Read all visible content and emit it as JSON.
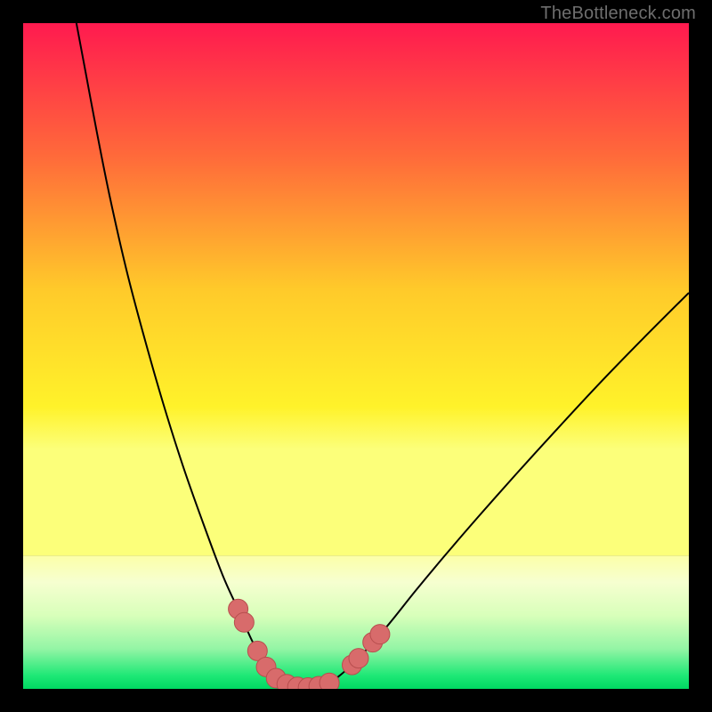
{
  "watermark": "TheBottleneck.com",
  "chart_data": {
    "type": "line",
    "title": "",
    "xlabel": "",
    "ylabel": "",
    "xlim": [
      0,
      100
    ],
    "ylim": [
      0,
      100
    ],
    "background_gradient_main": [
      {
        "offset": 0.0,
        "color": "#ff1a4f"
      },
      {
        "offset": 0.25,
        "color": "#ff6a3a"
      },
      {
        "offset": 0.5,
        "color": "#ffca2a"
      },
      {
        "offset": 0.72,
        "color": "#fff22a"
      },
      {
        "offset": 0.8,
        "color": "#fcff7a"
      }
    ],
    "bottom_band": {
      "start_y": 80,
      "colors": [
        {
          "offset": 0.0,
          "color": "#fcffa8"
        },
        {
          "offset": 0.2,
          "color": "#f6ffd0"
        },
        {
          "offset": 0.45,
          "color": "#d8ffba"
        },
        {
          "offset": 0.7,
          "color": "#93f5a5"
        },
        {
          "offset": 0.9,
          "color": "#1ee876"
        },
        {
          "offset": 1.0,
          "color": "#00d962"
        }
      ]
    },
    "curve_left": [
      {
        "x": 8.0,
        "y": 100.0
      },
      {
        "x": 9.5,
        "y": 92.0
      },
      {
        "x": 11.0,
        "y": 84.0
      },
      {
        "x": 13.0,
        "y": 74.0
      },
      {
        "x": 15.5,
        "y": 63.0
      },
      {
        "x": 18.0,
        "y": 53.5
      },
      {
        "x": 21.0,
        "y": 43.0
      },
      {
        "x": 24.0,
        "y": 33.5
      },
      {
        "x": 27.0,
        "y": 25.0
      },
      {
        "x": 30.0,
        "y": 17.0
      },
      {
        "x": 32.5,
        "y": 11.5
      },
      {
        "x": 34.5,
        "y": 7.0
      },
      {
        "x": 36.5,
        "y": 3.8
      },
      {
        "x": 38.5,
        "y": 1.7
      },
      {
        "x": 40.5,
        "y": 0.6
      },
      {
        "x": 42.0,
        "y": 0.2
      }
    ],
    "curve_right": [
      {
        "x": 44.0,
        "y": 0.2
      },
      {
        "x": 46.0,
        "y": 0.9
      },
      {
        "x": 48.5,
        "y": 2.8
      },
      {
        "x": 51.5,
        "y": 5.8
      },
      {
        "x": 55.0,
        "y": 9.8
      },
      {
        "x": 59.0,
        "y": 14.8
      },
      {
        "x": 63.5,
        "y": 20.2
      },
      {
        "x": 68.5,
        "y": 26.0
      },
      {
        "x": 74.0,
        "y": 32.2
      },
      {
        "x": 80.0,
        "y": 38.8
      },
      {
        "x": 86.5,
        "y": 45.8
      },
      {
        "x": 93.0,
        "y": 52.5
      },
      {
        "x": 100.0,
        "y": 59.5
      }
    ],
    "floor_line": {
      "x1": 42.0,
      "x2": 44.0,
      "y": 0.2
    },
    "markers": [
      {
        "x": 32.3,
        "y": 12.0
      },
      {
        "x": 33.2,
        "y": 10.0
      },
      {
        "x": 35.2,
        "y": 5.7
      },
      {
        "x": 36.5,
        "y": 3.3
      },
      {
        "x": 38.0,
        "y": 1.6
      },
      {
        "x": 39.6,
        "y": 0.7
      },
      {
        "x": 41.2,
        "y": 0.3
      },
      {
        "x": 42.8,
        "y": 0.2
      },
      {
        "x": 44.4,
        "y": 0.4
      },
      {
        "x": 46.0,
        "y": 0.9
      },
      {
        "x": 49.4,
        "y": 3.6
      },
      {
        "x": 50.4,
        "y": 4.6
      },
      {
        "x": 52.5,
        "y": 7.0
      },
      {
        "x": 53.6,
        "y": 8.2
      }
    ],
    "marker_style": {
      "fill": "#d86b6b",
      "stroke": "#b84e4e",
      "radius_px": 11
    }
  }
}
